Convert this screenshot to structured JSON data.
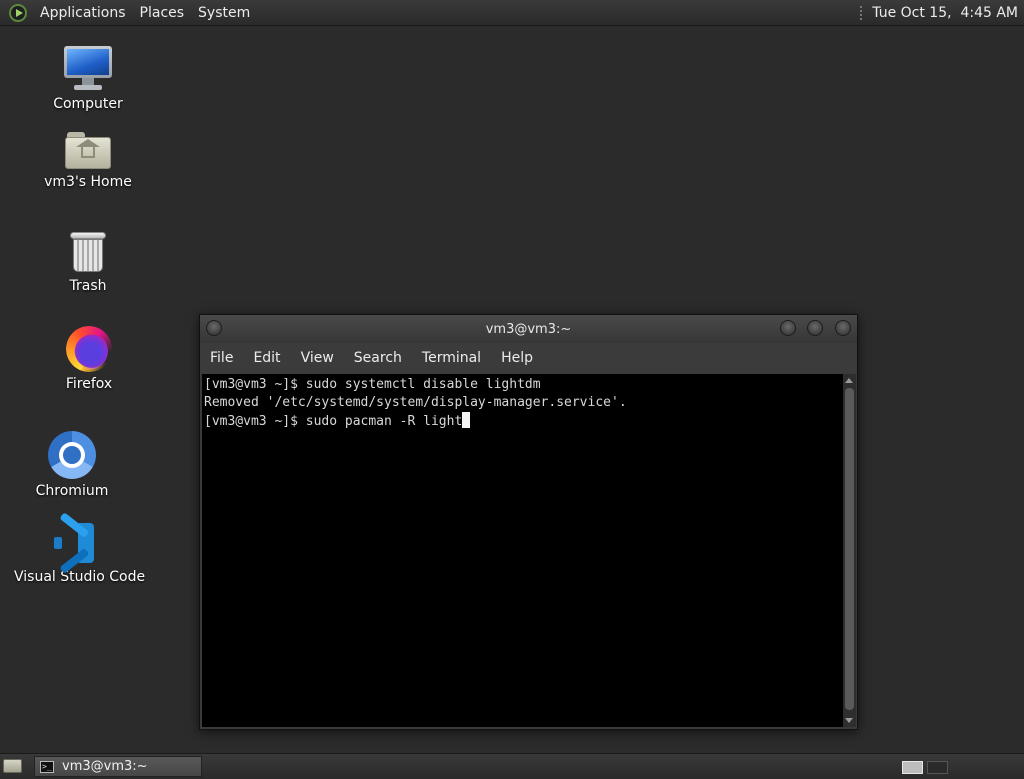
{
  "top_panel": {
    "menus": [
      "Applications",
      "Places",
      "System"
    ],
    "clock": "Tue Oct 15,  4:45 AM"
  },
  "desktop_icons": [
    {
      "label": "Computer",
      "icon": "computer-icon"
    },
    {
      "label": "vm3's Home",
      "icon": "home-folder-icon"
    },
    {
      "label": "Trash",
      "icon": "trash-icon"
    },
    {
      "label": "Firefox",
      "icon": "firefox-icon"
    },
    {
      "label": "Chromium",
      "icon": "chromium-icon"
    },
    {
      "label": "Visual Studio Code",
      "icon": "vscode-icon"
    }
  ],
  "terminal": {
    "title": "vm3@vm3:~",
    "menu": [
      "File",
      "Edit",
      "View",
      "Search",
      "Terminal",
      "Help"
    ],
    "lines": [
      "[vm3@vm3 ~]$ sudo systemctl disable lightdm",
      "Removed '/etc/systemd/system/display-manager.service'.",
      "[vm3@vm3 ~]$ sudo pacman -R light"
    ]
  },
  "bottom_panel": {
    "task_label": "vm3@vm3:~",
    "task_icon_glyph": ">_"
  }
}
